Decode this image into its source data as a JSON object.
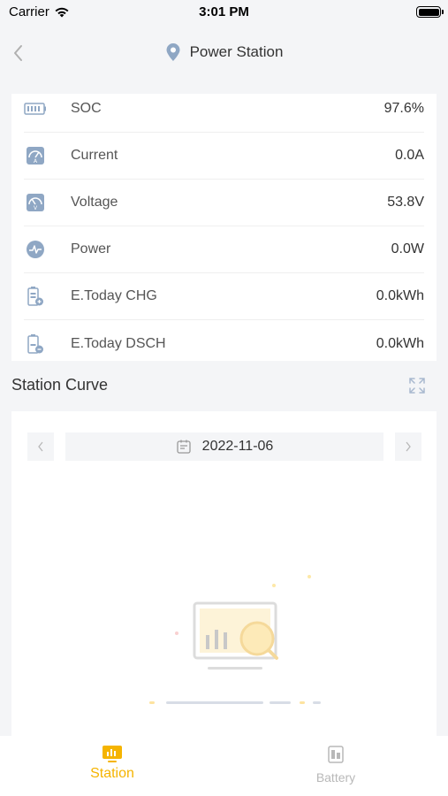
{
  "status_bar": {
    "carrier": "Carrier",
    "time": "3:01 PM"
  },
  "nav": {
    "title": "Power Station",
    "back_icon": "chevron-left-icon",
    "title_icon": "location-pin-icon"
  },
  "metrics": [
    {
      "label": "SOC",
      "value": "97.6%",
      "icon": "battery-bars-icon"
    },
    {
      "label": "Current",
      "value": "0.0A",
      "icon": "ammeter-icon"
    },
    {
      "label": "Voltage",
      "value": "53.8V",
      "icon": "voltmeter-icon"
    },
    {
      "label": "Power",
      "value": "0.0W",
      "icon": "power-gauge-icon"
    },
    {
      "label": "E.Today CHG",
      "value": "0.0kWh",
      "icon": "battery-charge-icon"
    },
    {
      "label": "E.Today DSCH",
      "value": "0.0kWh",
      "icon": "battery-discharge-icon"
    }
  ],
  "curve": {
    "title": "Station Curve",
    "date": "2022-11-06"
  },
  "tabs": [
    {
      "label": "Station",
      "active": true,
      "icon": "station-chart-icon"
    },
    {
      "label": "Battery",
      "active": false,
      "icon": "battery-tab-icon"
    }
  ],
  "colors": {
    "accent": "#f5b400",
    "inactive": "#b8b8b8",
    "background": "#f4f5f7"
  }
}
